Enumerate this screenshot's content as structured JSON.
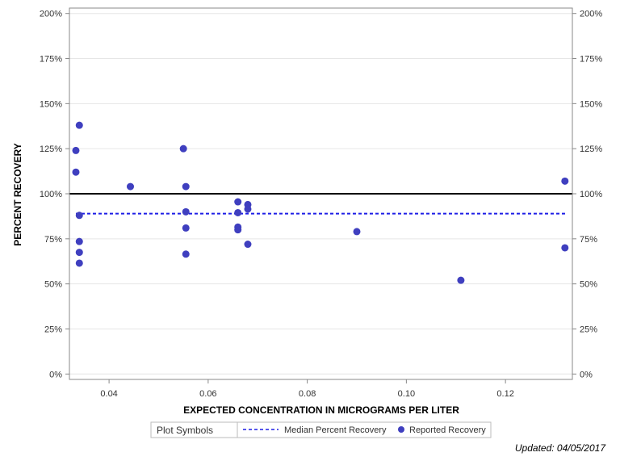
{
  "chart_data": {
    "type": "scatter",
    "title": "",
    "xlabel": "EXPECTED CONCENTRATION IN MICROGRAMS PER LITER",
    "ylabel": "PERCENT RECOVERY",
    "xlim": [
      0.032,
      0.1335
    ],
    "ylim": [
      -3,
      203
    ],
    "x_ticks": [
      0.04,
      0.06,
      0.08,
      0.1,
      0.12
    ],
    "x_tick_labels": [
      "0.04",
      "0.06",
      "0.08",
      "0.10",
      "0.12"
    ],
    "y_ticks": [
      0,
      25,
      50,
      75,
      100,
      125,
      150,
      175,
      200
    ],
    "y_tick_labels": [
      "0%",
      "25%",
      "50%",
      "75%",
      "100%",
      "125%",
      "150%",
      "175%",
      "200%"
    ],
    "reference_line": {
      "y": 100,
      "color": "#000000"
    },
    "median_line": {
      "name": "Median Percent Recovery",
      "y": 89,
      "x_range": [
        0.0333,
        0.1323
      ],
      "color": "#1e1ee6"
    },
    "series": [
      {
        "name": "Reported Recovery",
        "color": "#3f3fbf",
        "points": [
          [
            0.0333,
            124
          ],
          [
            0.0333,
            112
          ],
          [
            0.034,
            138
          ],
          [
            0.034,
            88
          ],
          [
            0.034,
            73.5
          ],
          [
            0.034,
            67.5
          ],
          [
            0.034,
            61.5
          ],
          [
            0.0443,
            104
          ],
          [
            0.055,
            125
          ],
          [
            0.0555,
            104
          ],
          [
            0.0555,
            90
          ],
          [
            0.0555,
            81
          ],
          [
            0.0555,
            66.5
          ],
          [
            0.066,
            95.5
          ],
          [
            0.066,
            89.5
          ],
          [
            0.066,
            81.5
          ],
          [
            0.066,
            80
          ],
          [
            0.068,
            94
          ],
          [
            0.068,
            91.5
          ],
          [
            0.068,
            72
          ],
          [
            0.09,
            79
          ],
          [
            0.111,
            52
          ],
          [
            0.132,
            107
          ],
          [
            0.132,
            70
          ]
        ]
      }
    ],
    "grid": true,
    "legend_position": "bottom-center"
  },
  "legend": {
    "title": "Plot Symbols",
    "median_label": "Median Percent Recovery",
    "reported_label": "Reported Recovery"
  },
  "footer": {
    "updated": "Updated: 04/05/2017"
  }
}
